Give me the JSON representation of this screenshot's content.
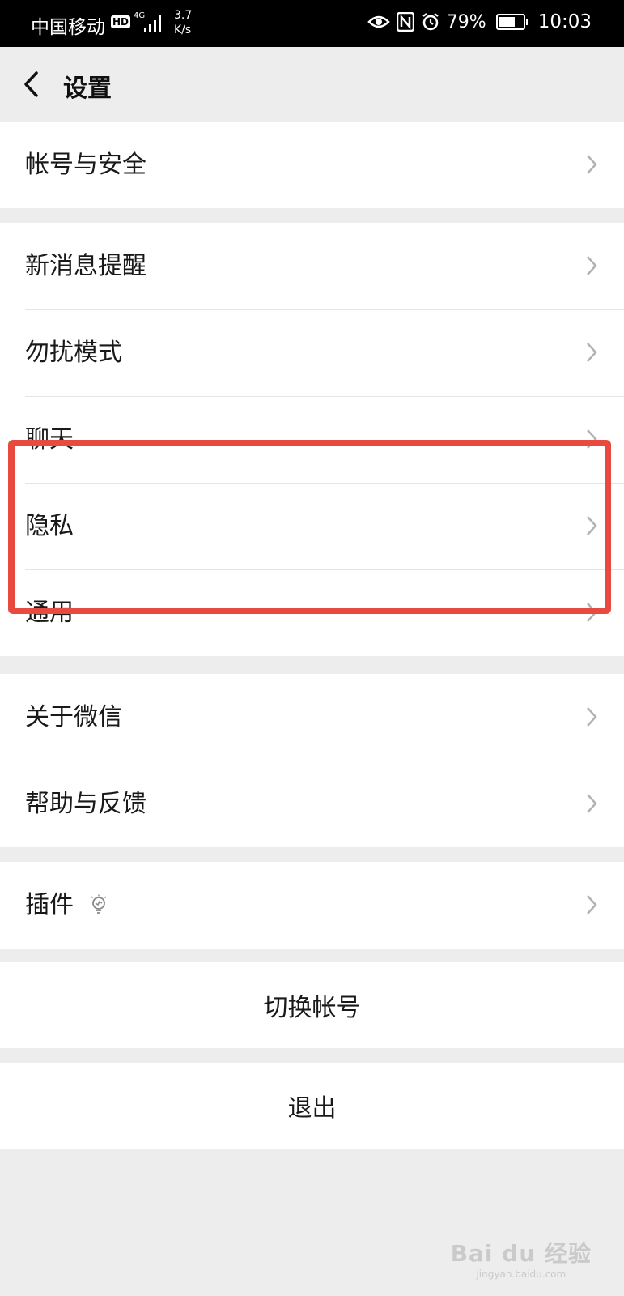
{
  "status_bar": {
    "carrier": "中国移动",
    "hd": "HD",
    "network": "4G",
    "speed_value": "3.7",
    "speed_unit": "K/s",
    "battery": "79%",
    "battery_level": 0.79,
    "time": "10:03"
  },
  "nav": {
    "title": "设置"
  },
  "groups": {
    "account": [
      "帐号与安全"
    ],
    "settings": [
      "新消息提醒",
      "勿扰模式",
      "聊天",
      "隐私",
      "通用"
    ],
    "about": [
      "关于微信",
      "帮助与反馈"
    ],
    "plugins": [
      "插件"
    ]
  },
  "actions": {
    "switch_account": "切换帐号",
    "logout": "退出"
  },
  "watermark": {
    "main": "Bai du 经验",
    "sub": "jingyan.baidu.com"
  },
  "colors": {
    "highlight": "#e84a3f",
    "background": "#ededed"
  }
}
